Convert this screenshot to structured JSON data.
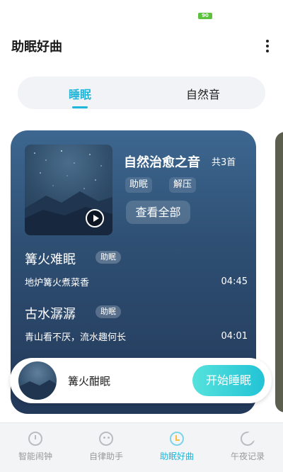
{
  "status_bar": {
    "battery_text": "90"
  },
  "header": {
    "title": "助眠好曲",
    "more_icon": "more-vertical-icon"
  },
  "tabs": [
    {
      "label": "睡眠",
      "active": true
    },
    {
      "label": "自然音",
      "active": false
    }
  ],
  "album": {
    "title": "自然治愈之音",
    "count": "共3首",
    "tags": [
      "助眠",
      "解压"
    ],
    "view_all_label": "查看全部",
    "play_icon": "play-icon"
  },
  "tracks": [
    {
      "name": "篝火难眠",
      "tag": "助眠",
      "desc": "地炉篝火煮菜香",
      "duration": "04:45"
    },
    {
      "name": "古水潺潺",
      "tag": "助眠",
      "desc": "青山看不厌，流水趣何长",
      "duration": "04:01"
    }
  ],
  "player": {
    "title": "篝火酣眠",
    "start_label": "开始睡眠"
  },
  "bottom_nav": [
    {
      "label": "智能闹钟",
      "icon": "alarm-clock-icon",
      "active": false
    },
    {
      "label": "自律助手",
      "icon": "face-icon",
      "active": false
    },
    {
      "label": "助眠好曲",
      "icon": "timer-icon",
      "active": true
    },
    {
      "label": "午夜记录",
      "icon": "moon-icon",
      "active": false
    }
  ],
  "colors": {
    "accent": "#1fb6d9",
    "card_top": "#3d6790",
    "card_bottom": "#23395a",
    "battery": "#5cc23e"
  }
}
